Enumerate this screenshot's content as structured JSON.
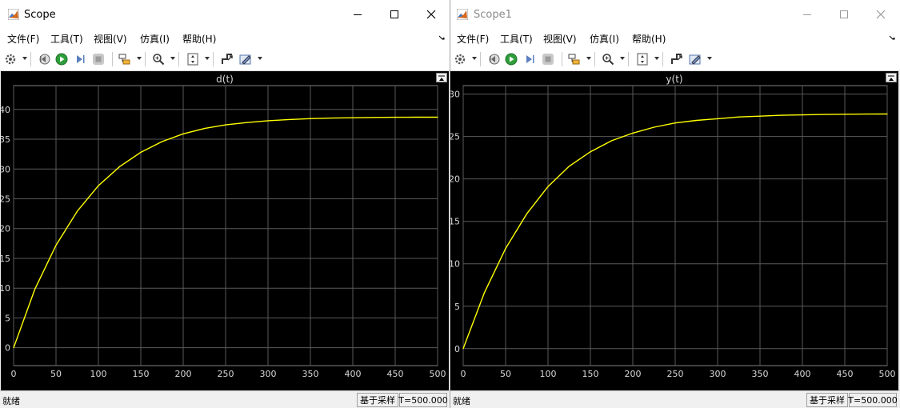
{
  "colors": {
    "plot_bg": "#000000",
    "axes_bg": "#000000",
    "grid": "#5a5a5a",
    "axis_text": "#d9d9d9",
    "trace": "#ffff00"
  },
  "menu": [
    "文件(F)",
    "工具(T)",
    "视图(V)",
    "仿真(I)",
    "帮助(H)"
  ],
  "toolbar_icons": [
    "gear-icon",
    "step-back-icon",
    "run-icon",
    "step-forward-icon",
    "stop-icon",
    "signal-select-icon",
    "zoom-icon",
    "autoscale-icon",
    "highlight-block-icon",
    "style-icon"
  ],
  "scopes": [
    {
      "window_title": "Scope",
      "status": "就绪",
      "sample_mode": "基于采样",
      "time": "T=500.000",
      "chart_data": {
        "type": "line",
        "title": "d(t)",
        "xlim": [
          0,
          500
        ],
        "ylim": [
          -3,
          44
        ],
        "xticks": [
          "0",
          "50",
          "100",
          "150",
          "200",
          "250",
          "300",
          "350",
          "400",
          "450",
          "500"
        ],
        "yticks": [
          "0",
          "5",
          "10",
          "15",
          "20",
          "25",
          "30",
          "35",
          "40"
        ],
        "grid": true,
        "series": [
          {
            "color": "#ffff00",
            "x": [
              0,
              25,
              50,
              75,
              100,
              125,
              150,
              175,
              200,
              225,
              250,
              275,
              300,
              325,
              350,
              375,
              400,
              425,
              450,
              475,
              500
            ],
            "y": [
              0,
              9.8,
              17.2,
              22.9,
              27.2,
              30.4,
              32.8,
              34.6,
              35.9,
              36.8,
              37.4,
              37.8,
              38.1,
              38.3,
              38.45,
              38.55,
              38.6,
              38.65,
              38.68,
              38.7,
              38.7
            ]
          }
        ]
      }
    },
    {
      "window_title": "Scope1",
      "status": "就绪",
      "sample_mode": "基于采样",
      "time": "T=500.000",
      "chart_data": {
        "type": "line",
        "title": "y(t)",
        "xlim": [
          0,
          500
        ],
        "ylim": [
          -2,
          31
        ],
        "xticks": [
          "0",
          "50",
          "100",
          "150",
          "200",
          "250",
          "300",
          "350",
          "400",
          "450",
          "500"
        ],
        "yticks": [
          "0",
          "5",
          "10",
          "15",
          "20",
          "25",
          "30"
        ],
        "grid": true,
        "series": [
          {
            "color": "#ffff00",
            "x": [
              0,
              25,
              50,
              75,
              100,
              125,
              150,
              175,
              200,
              225,
              250,
              275,
              300,
              325,
              350,
              375,
              400,
              425,
              450,
              475,
              500
            ],
            "y": [
              0,
              6.6,
              11.8,
              15.9,
              19.1,
              21.5,
              23.2,
              24.5,
              25.4,
              26.1,
              26.6,
              26.9,
              27.1,
              27.3,
              27.4,
              27.5,
              27.55,
              27.6,
              27.62,
              27.64,
              27.65
            ]
          }
        ]
      }
    }
  ]
}
